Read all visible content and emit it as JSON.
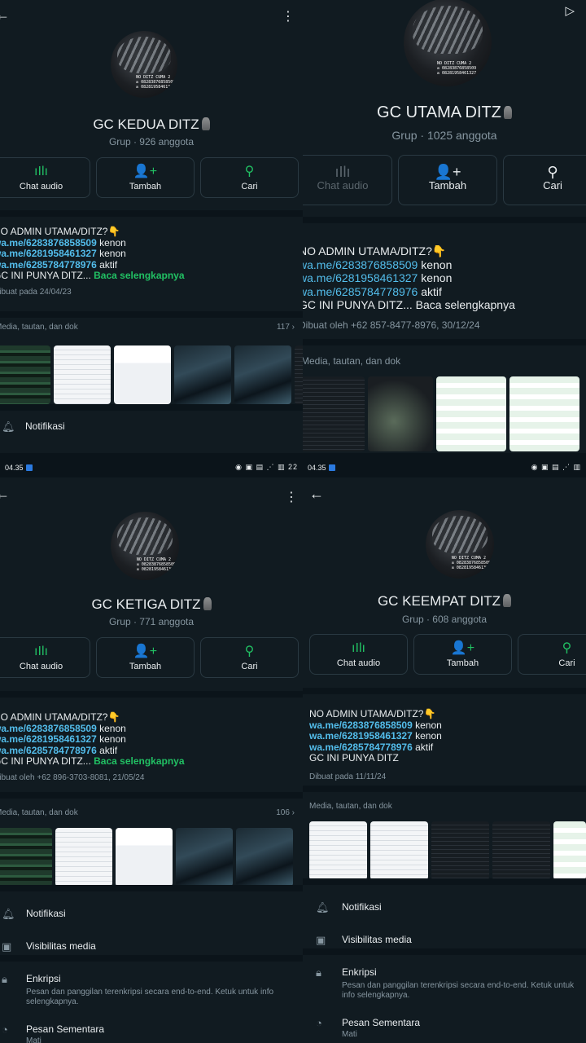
{
  "panel1": {
    "title": "GC KEDUA DITZ",
    "subtitle": "Grup · 926 anggota",
    "avatar_caption": "NO DITZ CUMA 2\n✉ 08283876858509\n✉ 08281958461327",
    "actions": [
      "Chat audio",
      "Tambah",
      "Cari"
    ],
    "desc": {
      "line1": "NO ADMIN UTAMA/DITZ?👇",
      "link1": "wa.me/6283876858509",
      "tag1": " kenon",
      "link2": "wa.me/6281958461327",
      "tag2": " kenon",
      "link3": "wa.me/6285784778976",
      "tag3": " aktif",
      "line5": "GC INI PUNYA DITZ...",
      "more": " Baca selengkapnya"
    },
    "meta": "Dibuat pada 24/04/23",
    "media_label": "Media, tautan, dan dok",
    "media_count": "117",
    "notif": "Notifikasi"
  },
  "panel2": {
    "title": "GC UTAMA DITZ",
    "subtitle": "Grup · 1025 anggota",
    "avatar_caption": "NO DITZ CUMA 2\n✉ 08283876858509\n✉ 08281958461327",
    "actions": [
      "Chat audio",
      "Tambah",
      "Cari"
    ],
    "desc": {
      "line1": "NO ADMIN UTAMA/DITZ?👇",
      "link1": "wa.me/6283876858509",
      "tag1": " kenon",
      "link2": "wa.me/6281958461327",
      "tag2": " kenon",
      "link3": "wa.me/6285784778976",
      "tag3": " aktif",
      "line5": "GC INI PUNYA DITZ...",
      "more": " Baca selengkapnya"
    },
    "meta": "Dibuat oleh +62 857-8477-8976, 30/12/24",
    "media_label": "Media, tautan, dan dok"
  },
  "panel3": {
    "status_time": "04.35",
    "status_icons": "◉ ▣ ▤ ⋰ ▥ 22",
    "title": "GC KETIGA DITZ",
    "subtitle": "Grup · 771 anggota",
    "avatar_caption": "NO DITZ CUMA 2\n✉ 08283876858509\n✉ 08281958461327",
    "actions": [
      "Chat audio",
      "Tambah",
      "Cari"
    ],
    "desc": {
      "line1": "NO ADMIN UTAMA/DITZ?👇",
      "link1": "wa.me/6283876858509",
      "tag1": " kenon",
      "link2": "wa.me/6281958461327",
      "tag2": " kenon",
      "link3": "wa.me/6285784778976",
      "tag3": " aktif",
      "line5": "GC INI PUNYA DITZ...",
      "more": " Baca selengkapnya"
    },
    "meta": "Dibuat oleh +62 896-3703-8081, 21/05/24",
    "media_label": "Media, tautan, dan dok",
    "media_count": "106",
    "notif": "Notifikasi",
    "visibility": "Visibilitas media",
    "encryption_title": "Enkripsi",
    "encryption_sub": "Pesan dan panggilan terenkripsi secara end-to-end. Ketuk untuk info selengkapnya.",
    "disappearing_title": "Pesan Sementara",
    "disappearing_sub": "Mati"
  },
  "panel4": {
    "status_time": "04.35",
    "status_icons": "◉ ▣ ▤ ⋰ ▥",
    "title": "GC KEEMPAT DITZ",
    "subtitle": "Grup · 608 anggota",
    "avatar_caption": "NO DITZ CUMA 2\n✉ 08283876858509\n✉ 08281958461327",
    "actions": [
      "Chat audio",
      "Tambah",
      "Cari"
    ],
    "desc": {
      "line1": "NO ADMIN UTAMA/DITZ?👇",
      "link1": "wa.me/6283876858509",
      "tag1": " kenon",
      "link2": "wa.me/6281958461327",
      "tag2": " kenon",
      "link3": "wa.me/6285784778976",
      "tag3": " aktif",
      "line5": "GC INI PUNYA DITZ"
    },
    "meta": "Dibuat pada 11/11/24",
    "media_label": "Media, tautan, dan dok",
    "notif": "Notifikasi",
    "visibility": "Visibilitas media",
    "encryption_title": "Enkripsi",
    "encryption_sub": "Pesan dan panggilan terenkripsi secara end-to-end. Ketuk untuk info selengkapnya.",
    "disappearing_title": "Pesan Sementara",
    "disappearing_sub": "Mati"
  },
  "colors": {
    "bg": "#111b21",
    "link": "#53bdeb",
    "accent": "#21c063",
    "muted": "#8696a0"
  }
}
